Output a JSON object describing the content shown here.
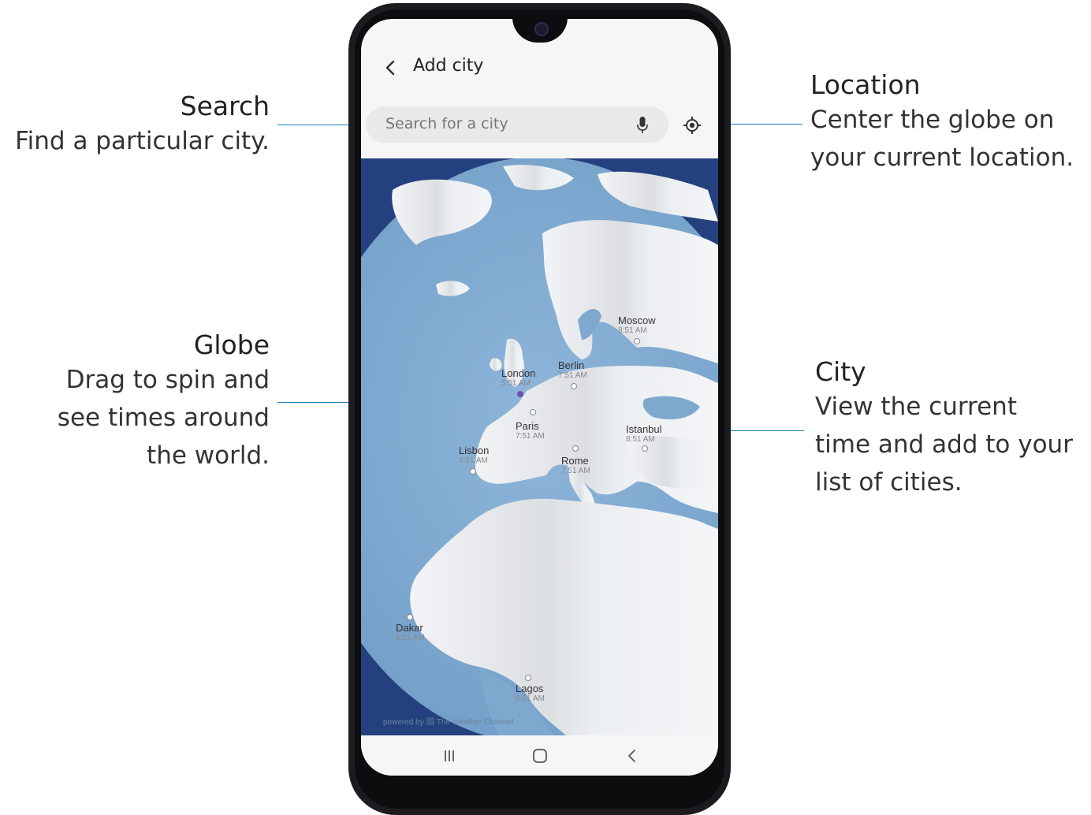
{
  "callouts": {
    "search": {
      "title": "Search",
      "desc": "Find a particular city."
    },
    "location": {
      "title": "Location",
      "desc_line1": "Center the globe on",
      "desc_line2": "your current location."
    },
    "globe": {
      "title": "Globe",
      "desc_line1": "Drag to spin and",
      "desc_line2": "see times around",
      "desc_line3": "the world."
    },
    "city": {
      "title": "City",
      "desc_line1": "View the current",
      "desc_line2": "time and add to your",
      "desc_line3": "list of cities."
    }
  },
  "app": {
    "title": "Add city",
    "search_placeholder": "Search for a city",
    "powered_by_prefix": "powered by",
    "powered_by_brand": "The Weather Channel"
  },
  "cities": [
    {
      "name": "Moscow",
      "time": "8:51 AM"
    },
    {
      "name": "London",
      "time": "5:51 AM"
    },
    {
      "name": "Berlin",
      "time": "7:51 AM"
    },
    {
      "name": "Paris",
      "time": "7:51 AM"
    },
    {
      "name": "Istanbul",
      "time": "8:51 AM"
    },
    {
      "name": "Lisbon",
      "time": "6:51 AM"
    },
    {
      "name": "Rome",
      "time": "7:51 AM"
    },
    {
      "name": "Dakar",
      "time": "5:51 AM"
    },
    {
      "name": "Lagos",
      "time": "6:51 AM"
    }
  ],
  "colors": {
    "ocean": "#7fa8cf",
    "land": "#eef1f3",
    "accent": "#1a7fb5"
  },
  "icons": {
    "back": "chevron-left-icon",
    "mic": "mic-icon",
    "location": "crosshair-icon",
    "recents": "recents-icon",
    "home": "home-icon",
    "nav_back": "nav-back-icon"
  }
}
